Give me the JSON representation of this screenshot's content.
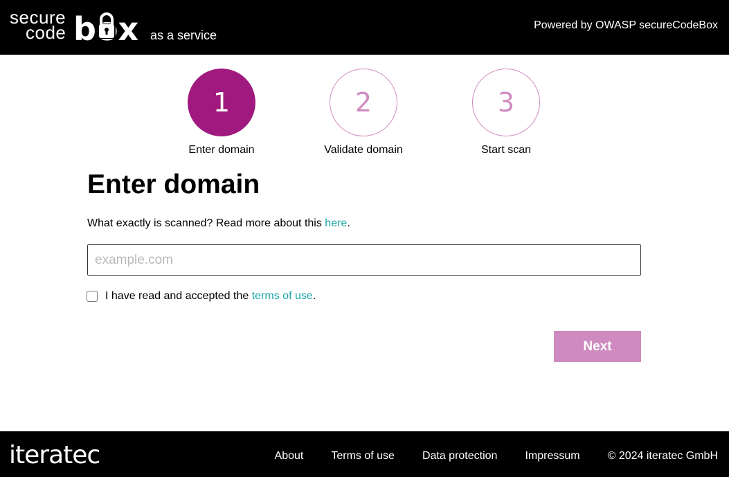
{
  "header": {
    "logo": {
      "line1": "secure",
      "line2": "code",
      "line3": "box",
      "suffix": "as a service"
    },
    "powered_by": "Powered by OWASP secureCodeBox"
  },
  "stepper": {
    "steps": [
      {
        "number": "1",
        "label": "Enter domain",
        "state": "active"
      },
      {
        "number": "2",
        "label": "Validate domain",
        "state": "inactive"
      },
      {
        "number": "3",
        "label": "Start scan",
        "state": "inactive"
      }
    ]
  },
  "main": {
    "title": "Enter domain",
    "intro_text": "What exactly is scanned? Read more about this ",
    "intro_link": "here",
    "intro_end": ".",
    "domain_input": {
      "placeholder": "example.com",
      "value": ""
    },
    "terms": {
      "checked": false,
      "text": "I have read and accepted the ",
      "link": "terms of use",
      "end": "."
    },
    "next_label": "Next"
  },
  "footer": {
    "logo_text": "iteratec",
    "links": [
      "About",
      "Terms of use",
      "Data protection",
      "Impressum"
    ],
    "copyright": "© 2024 iteratec GmbH"
  },
  "colors": {
    "brand_purple": "#a0197e",
    "brand_purple_light": "#cf8bbf",
    "link_teal": "#1aa6a6",
    "header_bg": "#000000"
  }
}
